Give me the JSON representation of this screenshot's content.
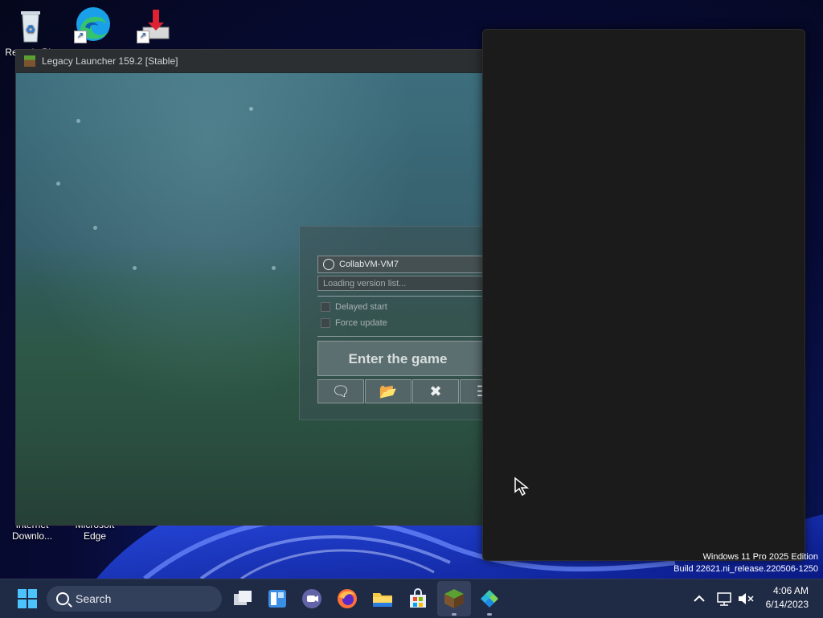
{
  "desktop": {
    "icons": [
      {
        "label": "Recycle Bin",
        "icon": "recycle-bin-icon"
      },
      {
        "label": "",
        "icon": "edge-icon"
      },
      {
        "label": "",
        "icon": "installer-icon"
      },
      {
        "label": "Internet Downlo...",
        "icon": "internet-download-manager-icon"
      },
      {
        "label": "Microsoft Edge",
        "icon": "edge-icon"
      }
    ]
  },
  "launcher": {
    "title": "Legacy Launcher 159.2 [Stable]",
    "account": "CollabVM-VM7",
    "version_placeholder": "Loading version list...",
    "options": [
      {
        "label": "Delayed start",
        "checked": false
      },
      {
        "label": "Force update",
        "checked": false
      }
    ],
    "enter_label": "Enter the game",
    "toolbar": [
      {
        "icon": "chat-icon",
        "glyph": "🗨"
      },
      {
        "icon": "folder-icon",
        "glyph": "📂"
      },
      {
        "icon": "close-icon",
        "glyph": "✖"
      },
      {
        "icon": "menu-icon",
        "glyph": "☰"
      }
    ]
  },
  "watermark": {
    "line1": "Windows 11 Pro 2025 Edition",
    "line2": "Build 22621.ni_release.220506-1250"
  },
  "taskbar": {
    "search_label": "Search",
    "apps": [
      "start-icon",
      "task-view-icon",
      "widgets-icon",
      "teams-icon",
      "firefox-icon",
      "file-explorer-icon",
      "store-icon",
      "legacy-launcher-icon",
      "app-icon"
    ],
    "clock_time": "4:06 AM",
    "clock_date": "6/14/2023"
  }
}
